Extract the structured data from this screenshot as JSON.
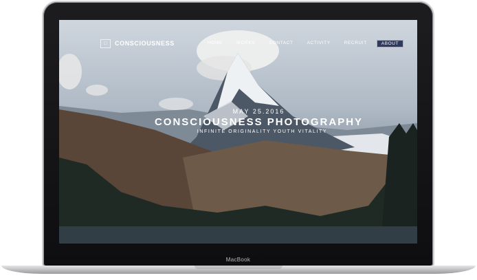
{
  "site": {
    "logo_mark": "□",
    "logo_text": "CONSCIOUSNESS"
  },
  "nav": {
    "items": [
      {
        "label": "HOME"
      },
      {
        "label": "WORKS"
      },
      {
        "label": "CONTACT"
      },
      {
        "label": "ACTIVITY"
      },
      {
        "label": "RECRUIT"
      },
      {
        "label": "ABOUT",
        "active": true
      }
    ],
    "active_color": "#2c3b5e"
  },
  "hero": {
    "date": "MAY 25.2016",
    "title": "CONSCIOUSNESS  PHOTOGRAPHY",
    "tagline": "INFINITE ORIGINALITY YOUTH VITALITY"
  },
  "device": {
    "brand": "MacBook"
  }
}
